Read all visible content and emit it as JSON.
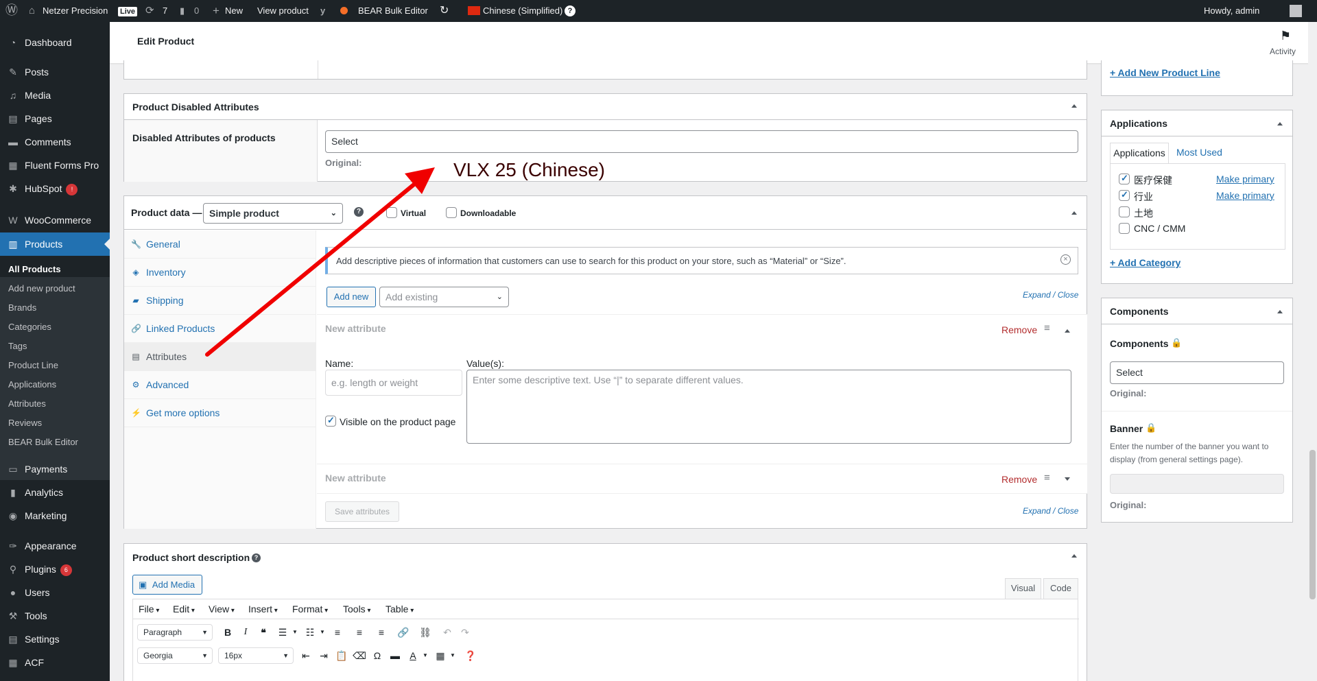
{
  "adminbar": {
    "site_name": "Netzer Precision",
    "live_badge": "Live",
    "updates_count": "7",
    "comments_count": "0",
    "new_label": "New",
    "view_product": "View product",
    "bulk_editor": "BEAR Bulk Editor",
    "language": "Chinese (Simplified)",
    "howdy": "Howdy, admin"
  },
  "sidebar": {
    "items": [
      {
        "label": "Dashboard",
        "icon": "dashboard-icon"
      },
      {
        "label": "Posts",
        "icon": "pin-icon"
      },
      {
        "label": "Media",
        "icon": "media-icon"
      },
      {
        "label": "Pages",
        "icon": "page-icon"
      },
      {
        "label": "Comments",
        "icon": "comment-icon"
      },
      {
        "label": "Fluent Forms Pro",
        "icon": "forms-icon"
      },
      {
        "label": "HubSpot",
        "icon": "hubspot-icon",
        "badge": "!"
      },
      {
        "label": "WooCommerce",
        "icon": "woo-icon"
      },
      {
        "label": "Products",
        "icon": "products-icon"
      },
      {
        "label": "Payments",
        "icon": "payments-icon"
      },
      {
        "label": "Analytics",
        "icon": "analytics-icon"
      },
      {
        "label": "Marketing",
        "icon": "marketing-icon"
      },
      {
        "label": "Appearance",
        "icon": "appearance-icon"
      },
      {
        "label": "Plugins",
        "icon": "plugins-icon",
        "badge": "6"
      },
      {
        "label": "Users",
        "icon": "users-icon"
      },
      {
        "label": "Tools",
        "icon": "tools-icon"
      },
      {
        "label": "Settings",
        "icon": "settings-icon"
      },
      {
        "label": "ACF",
        "icon": "acf-icon"
      }
    ],
    "products_submenu": [
      "All Products",
      "Add new product",
      "Brands",
      "Categories",
      "Tags",
      "Product Line",
      "Applications",
      "Attributes",
      "Reviews",
      "BEAR Bulk Editor"
    ]
  },
  "header": {
    "title": "Edit Product",
    "activity": "Activity"
  },
  "disabled_attrs": {
    "title": "Product Disabled Attributes",
    "label": "Disabled Attributes of products",
    "select": "Select",
    "original": "Original:"
  },
  "annotation": {
    "text": "VLX 25 (Chinese)",
    "color": "#e60000"
  },
  "product_data": {
    "label": "Product data —",
    "type": "Simple product",
    "virtual": "Virtual",
    "downloadable": "Downloadable",
    "tabs": [
      {
        "label": "General",
        "icon": "wrench-icon"
      },
      {
        "label": "Inventory",
        "icon": "tag-icon"
      },
      {
        "label": "Shipping",
        "icon": "truck-icon"
      },
      {
        "label": "Linked Products",
        "icon": "link-icon"
      },
      {
        "label": "Attributes",
        "icon": "list-icon"
      },
      {
        "label": "Advanced",
        "icon": "gear-icon"
      },
      {
        "label": "Get more options",
        "icon": "plugin-icon"
      }
    ],
    "notice": "Add descriptive pieces of information that customers can use to search for this product on your store, such as “Material” or “Size”.",
    "add_new": "Add new",
    "add_existing": "Add existing",
    "expand_close": "Expand / Close",
    "attr1": {
      "title": "New attribute",
      "remove": "Remove",
      "name_label": "Name:",
      "name_placeholder": "e.g. length or weight",
      "values_label": "Value(s):",
      "values_placeholder": "Enter some descriptive text. Use “|” to separate different values.",
      "visible": "Visible on the product page"
    },
    "attr2": {
      "title": "New attribute",
      "remove": "Remove"
    },
    "save": "Save attributes"
  },
  "short_desc": {
    "title": "Product short description",
    "add_media": "Add Media",
    "visual": "Visual",
    "code": "Code",
    "menus": [
      "File",
      "Edit",
      "View",
      "Insert",
      "Format",
      "Tools",
      "Table"
    ],
    "paragraph": "Paragraph",
    "font": "Georgia",
    "size": "16px"
  },
  "right": {
    "add_product_line": "+ Add New Product Line",
    "applications": {
      "title": "Applications",
      "tab_all": "Applications",
      "tab_used": "Most Used",
      "items": [
        {
          "label": "医疗保健",
          "checked": true,
          "primary": "Make primary"
        },
        {
          "label": "行业",
          "checked": true,
          "primary": "Make primary"
        },
        {
          "label": "土地",
          "checked": false,
          "primary": ""
        },
        {
          "label": "CNC / CMM",
          "checked": false,
          "primary": ""
        }
      ],
      "add_category": "+ Add Category"
    },
    "components": {
      "title": "Components",
      "field_label": "Components",
      "select": "Select",
      "original": "Original:",
      "banner_label": "Banner",
      "banner_help": "Enter the number of the banner you want to display (from general settings page).",
      "banner_original": "Original:"
    }
  }
}
